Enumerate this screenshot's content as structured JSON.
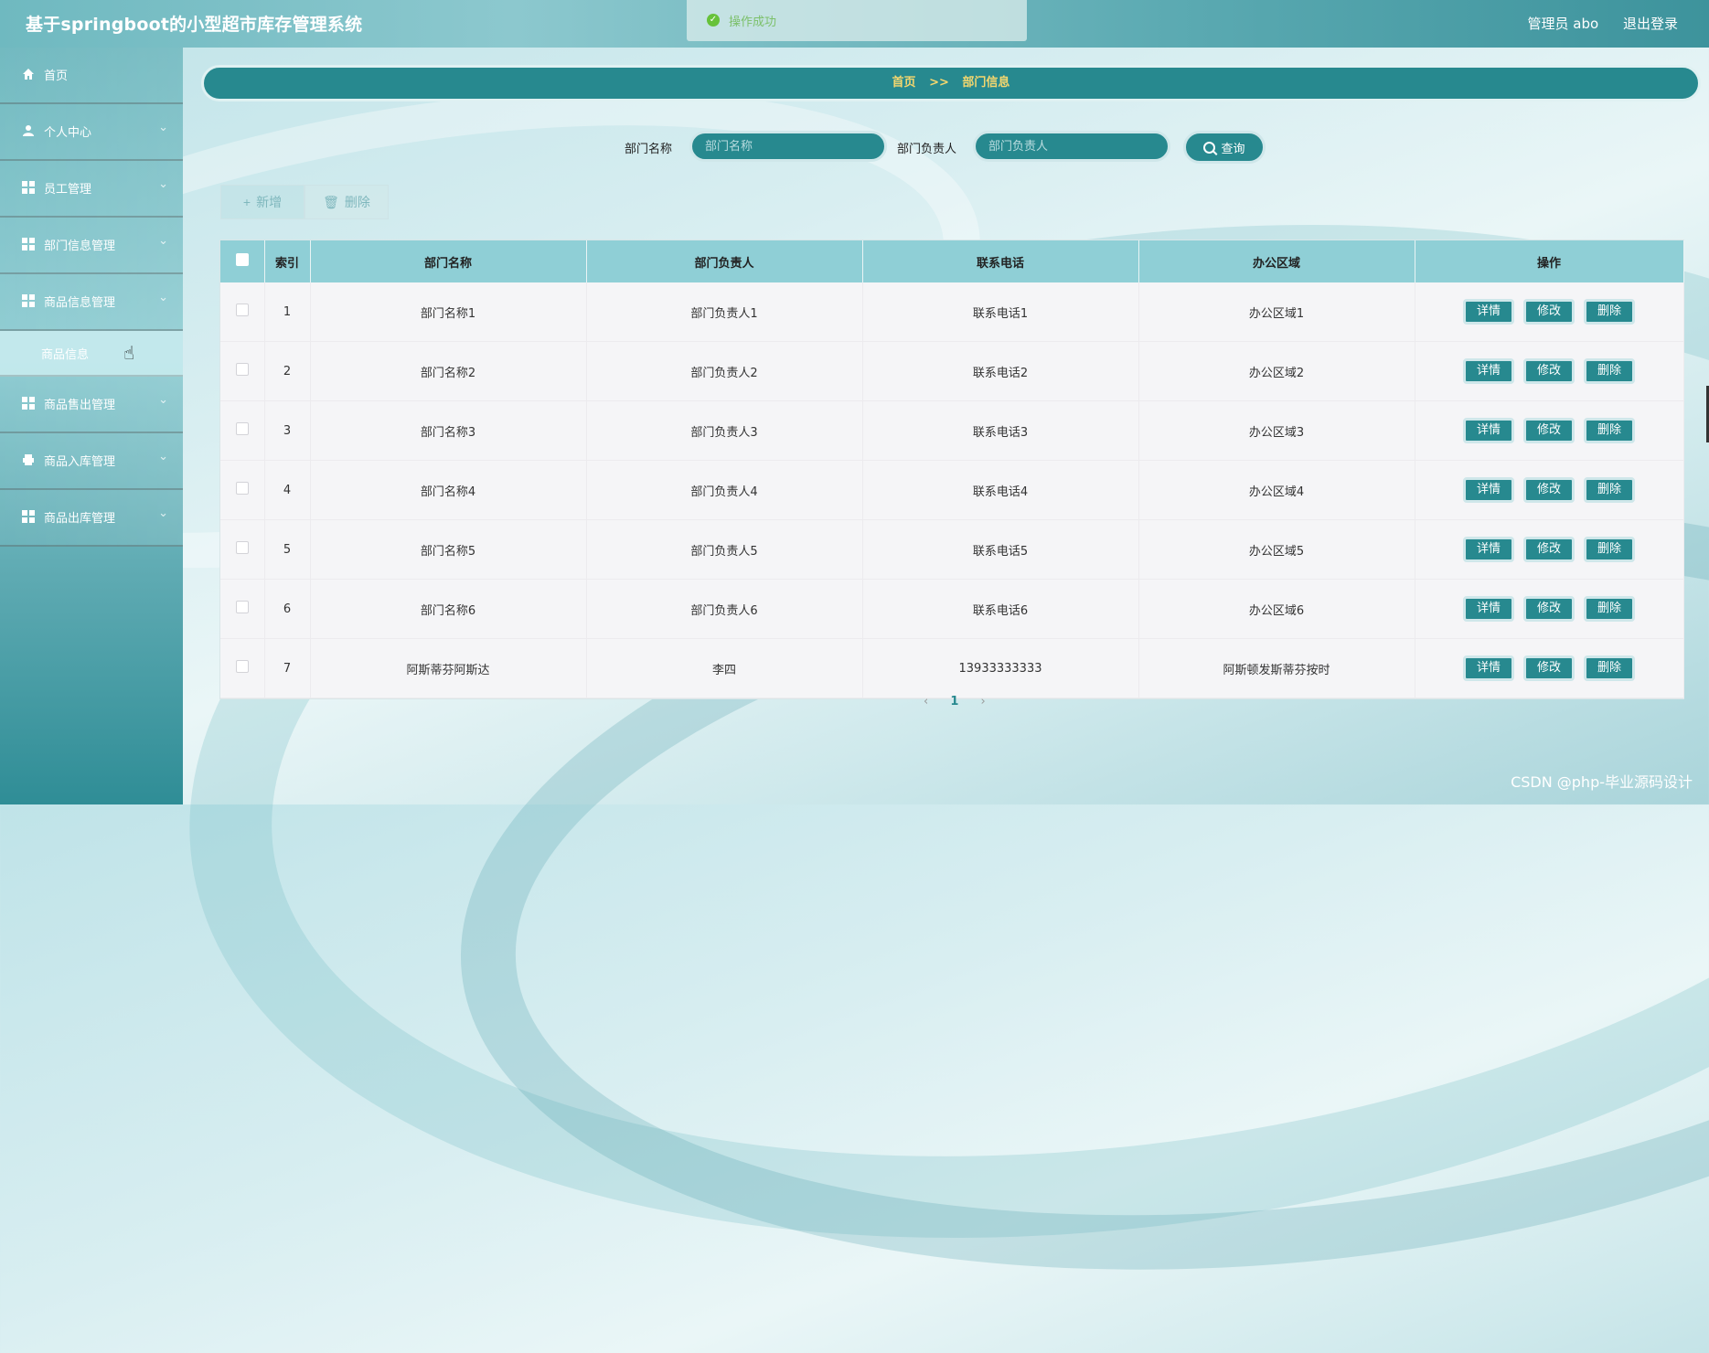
{
  "app": {
    "title": "基于springboot的小型超市库存管理系统",
    "user_label": "管理员 abo",
    "logout_label": "退出登录"
  },
  "toast": {
    "message": "操作成功"
  },
  "sidebar": {
    "items": [
      {
        "label": "首页",
        "icon": "home-icon"
      },
      {
        "label": "个人中心",
        "icon": "user-icon"
      },
      {
        "label": "员工管理",
        "icon": "grid-icon"
      },
      {
        "label": "部门信息管理",
        "icon": "grid-icon"
      },
      {
        "label": "商品信息管理",
        "icon": "grid-icon"
      },
      {
        "label": "商品售出管理",
        "icon": "grid-icon"
      },
      {
        "label": "商品入库管理",
        "icon": "printer-icon"
      },
      {
        "label": "商品出库管理",
        "icon": "grid-icon"
      }
    ],
    "active_subitem": "商品信息"
  },
  "breadcrumb": {
    "home": "首页",
    "separator": ">>",
    "current": "部门信息"
  },
  "search": {
    "dept_name_label": "部门名称",
    "dept_name_placeholder": "部门名称",
    "dept_head_label": "部门负责人",
    "dept_head_placeholder": "部门负责人",
    "query_label": "查询"
  },
  "toolbar": {
    "add_label": "新增",
    "delete_label": "删除"
  },
  "table": {
    "headers": [
      "索引",
      "部门名称",
      "部门负责人",
      "联系电话",
      "办公区域",
      "操作"
    ],
    "rows": [
      {
        "index": "1",
        "name": "部门名称1",
        "head": "部门负责人1",
        "phone": "联系电话1",
        "area": "办公区域1"
      },
      {
        "index": "2",
        "name": "部门名称2",
        "head": "部门负责人2",
        "phone": "联系电话2",
        "area": "办公区域2"
      },
      {
        "index": "3",
        "name": "部门名称3",
        "head": "部门负责人3",
        "phone": "联系电话3",
        "area": "办公区域3"
      },
      {
        "index": "4",
        "name": "部门名称4",
        "head": "部门负责人4",
        "phone": "联系电话4",
        "area": "办公区域4"
      },
      {
        "index": "5",
        "name": "部门名称5",
        "head": "部门负责人5",
        "phone": "联系电话5",
        "area": "办公区域5"
      },
      {
        "index": "6",
        "name": "部门名称6",
        "head": "部门负责人6",
        "phone": "联系电话6",
        "area": "办公区域6"
      },
      {
        "index": "7",
        "name": "阿斯蒂芬阿斯达",
        "head": "李四",
        "phone": "13933333333",
        "area": "阿斯顿发斯蒂芬按时"
      }
    ],
    "ops": {
      "detail": "详情",
      "edit": "修改",
      "delete": "删除"
    }
  },
  "pager": {
    "prev": "‹",
    "current": "1",
    "next": "›"
  },
  "watermark": "CSDN @php-毕业源码设计",
  "colors": {
    "accent": "#27898f",
    "header_th": "#8fcfd6",
    "breadcrumb_text": "#f5d76e"
  }
}
